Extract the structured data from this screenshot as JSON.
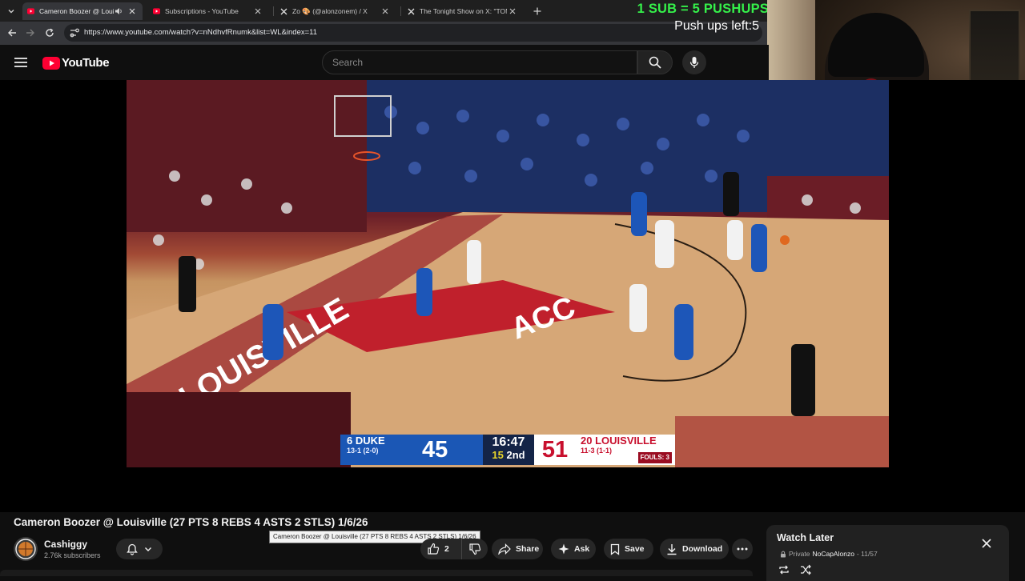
{
  "browser": {
    "tabs": [
      {
        "title": "Cameron Boozer @ Louisville",
        "favicon": "youtube-icon",
        "active": true,
        "audio": true
      },
      {
        "title": "Subscriptions - YouTube",
        "favicon": "youtube-icon",
        "active": false
      },
      {
        "title": "Zo 🎨 (@alonzonem) / X",
        "favicon": "x-icon",
        "active": false
      },
      {
        "title": "The Tonight Show on X: \"TONIGHT",
        "favicon": "x-icon",
        "active": false
      }
    ],
    "url": "https://www.youtube.com/watch?v=nNdhvfRnumk&list=WL&index=11"
  },
  "overlay": {
    "headline": "1 SUB = 5 PUSHUPS",
    "counter": "Push ups left:5"
  },
  "youtube": {
    "logo_text": "YouTube",
    "search_placeholder": "Search"
  },
  "scoreboard": {
    "away": {
      "rank": "6",
      "team": "DUKE",
      "record": "13-1 (2-0)",
      "score": "45"
    },
    "clock": "16:47",
    "quarter": "15",
    "period": "2nd",
    "home": {
      "rank": "20",
      "team": "LOUISVILLE",
      "record": "11-3 (1-1)",
      "score": "51",
      "fouls": "FOULS: 3"
    }
  },
  "video": {
    "title": "Cameron Boozer @ Louisville (27 PTS 8 REBS 4 ASTS 2 STLS) 1/6/26",
    "tooltip": "Cameron Boozer @ Louisville (27 PTS 8 REBS 4 ASTS 2 STLS) 1/6/26",
    "channel": "Cashiggy",
    "subscribers": "2.76k subscribers",
    "likes": "2",
    "actions": {
      "share": "Share",
      "ask": "Ask",
      "save": "Save",
      "download": "Download"
    }
  },
  "playlist": {
    "title": "Watch Later",
    "privacy": "Private",
    "owner": "NoCapAlonzo",
    "position": "- 11/57"
  },
  "colors": {
    "yt_red": "#ff0033",
    "promo_green": "#35f04a",
    "duke_blue": "#1b57b5",
    "louisville_red": "#c8102e"
  }
}
